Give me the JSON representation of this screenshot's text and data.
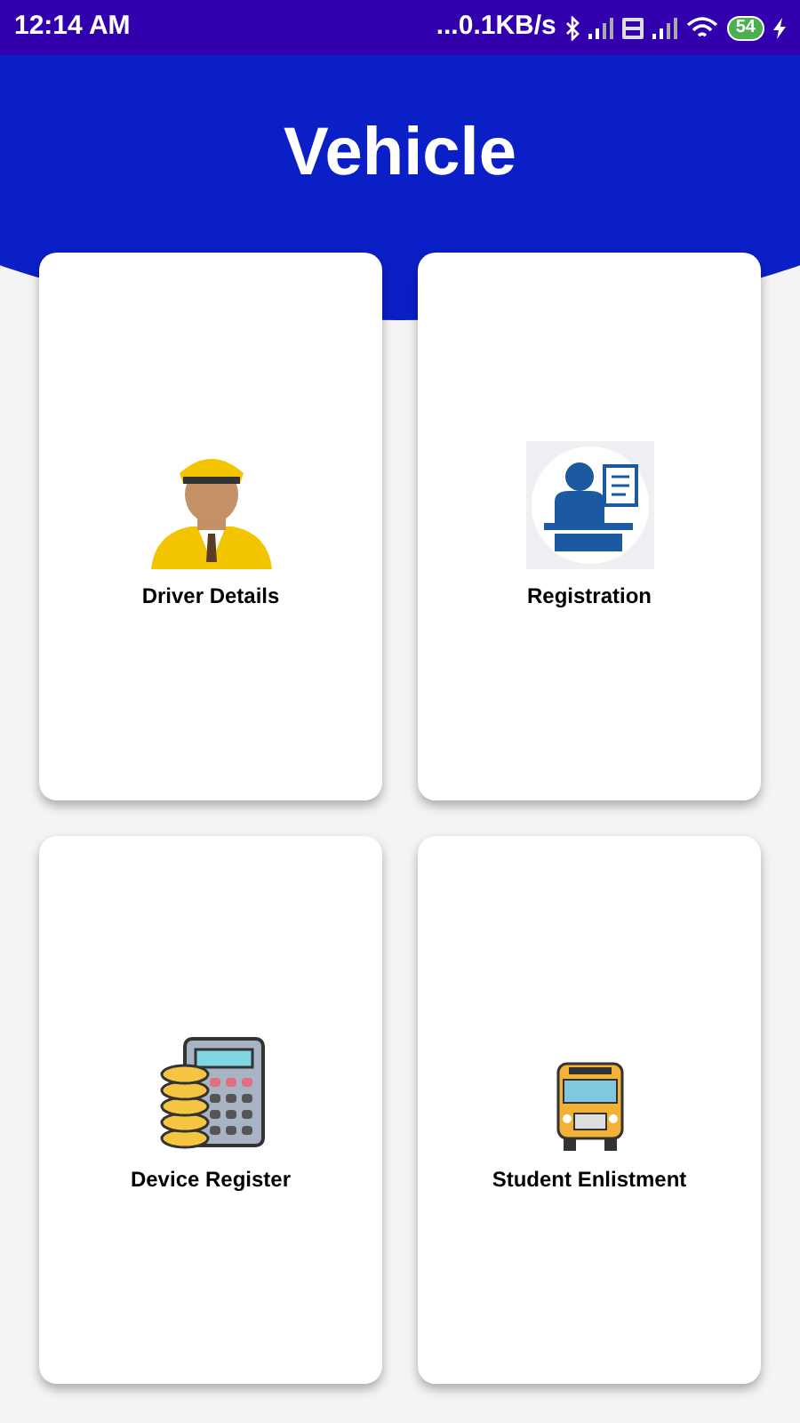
{
  "status_bar": {
    "time": "12:14 AM",
    "speed": "...0.1KB/s",
    "battery": "54"
  },
  "title": "Vehicle",
  "cards": [
    {
      "kind": "driver",
      "label": "Driver Details"
    },
    {
      "kind": "registration",
      "label": "Registration"
    },
    {
      "kind": "calculator",
      "label": "Device Register"
    },
    {
      "kind": "bus",
      "label": "Student Enlistment"
    }
  ]
}
